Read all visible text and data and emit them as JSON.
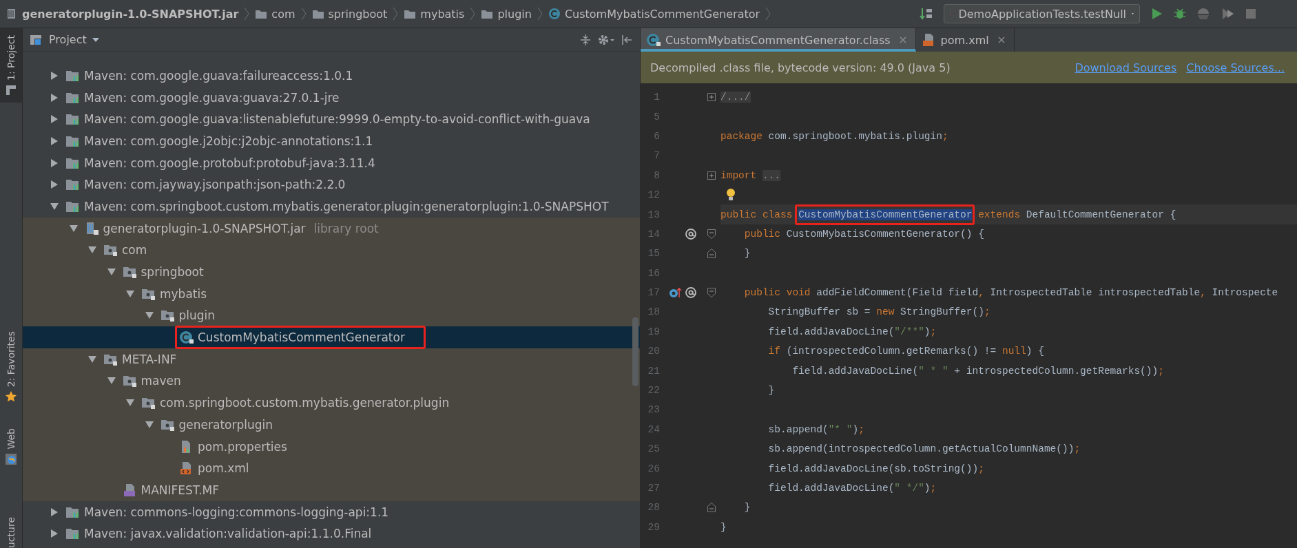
{
  "navigation_bar": {
    "breadcrumbs": [
      {
        "label": "generatorplugin-1.0-SNAPSHOT.jar",
        "kind": "jar"
      },
      {
        "label": "com",
        "kind": "package"
      },
      {
        "label": "springboot",
        "kind": "package"
      },
      {
        "label": "mybatis",
        "kind": "package"
      },
      {
        "label": "plugin",
        "kind": "package"
      },
      {
        "label": "CustomMybatisCommentGenerator",
        "kind": "class"
      }
    ],
    "run_configuration": {
      "label": "DemoApplicationTests.testNull"
    }
  },
  "side_tabs": [
    {
      "label": "1: Project",
      "kind": "project",
      "selected": true
    },
    {
      "label": "2: Favorites",
      "kind": "favorites",
      "selected": false
    },
    {
      "label": "Web",
      "kind": "web",
      "selected": false
    },
    {
      "label": "ucture",
      "kind": "structure",
      "selected": false
    }
  ],
  "project_panel": {
    "title": "Project",
    "tree": [
      {
        "label": "Maven: com.google.guava:failureaccess:1.0.1",
        "kind": "library",
        "expanded": false,
        "selected": false
      },
      {
        "label": "Maven: com.google.guava:guava:27.0.1-jre",
        "kind": "library",
        "expanded": false,
        "selected": false
      },
      {
        "label": "Maven: com.google.guava:listenablefuture:9999.0-empty-to-avoid-conflict-with-guava",
        "kind": "library",
        "expanded": false,
        "selected": false
      },
      {
        "label": "Maven: com.google.j2objc:j2objc-annotations:1.1",
        "kind": "library",
        "expanded": false,
        "selected": false
      },
      {
        "label": "Maven: com.google.protobuf:protobuf-java:3.11.4",
        "kind": "library",
        "expanded": false,
        "selected": false
      },
      {
        "label": "Maven: com.jayway.jsonpath:json-path:2.2.0",
        "kind": "library",
        "expanded": false,
        "selected": false
      },
      {
        "label": "Maven: com.springboot.custom.mybatis.generator.plugin:generatorplugin:1.0-SNAPSHOT",
        "kind": "library",
        "expanded": true,
        "selected": false,
        "children": [
          {
            "label": "generatorplugin-1.0-SNAPSHOT.jar",
            "hint": "library root",
            "kind": "jar",
            "expanded": true,
            "selected": false,
            "children": [
              {
                "label": "com",
                "kind": "package",
                "expanded": true,
                "selected": false,
                "children": [
                  {
                    "label": "springboot",
                    "kind": "package",
                    "expanded": true,
                    "selected": false,
                    "children": [
                      {
                        "label": "mybatis",
                        "kind": "package",
                        "expanded": true,
                        "selected": false,
                        "children": [
                          {
                            "label": "plugin",
                            "kind": "package",
                            "expanded": true,
                            "selected": false,
                            "children": [
                              {
                                "label": "CustomMybatisCommentGenerator",
                                "kind": "class",
                                "selected": true,
                                "annotated": true
                              }
                            ]
                          }
                        ]
                      }
                    ]
                  }
                ]
              },
              {
                "label": "META-INF",
                "kind": "package",
                "expanded": true,
                "selected": false,
                "children": [
                  {
                    "label": "maven",
                    "kind": "package",
                    "expanded": true,
                    "selected": false,
                    "children": [
                      {
                        "label": "com.springboot.custom.mybatis.generator.plugin",
                        "kind": "package",
                        "expanded": true,
                        "selected": false,
                        "children": [
                          {
                            "label": "generatorplugin",
                            "kind": "package",
                            "expanded": true,
                            "selected": false,
                            "children": [
                              {
                                "label": "pom.properties",
                                "kind": "properties",
                                "selected": false
                              },
                              {
                                "label": "pom.xml",
                                "kind": "xml",
                                "selected": false
                              }
                            ]
                          }
                        ]
                      }
                    ]
                  },
                  {
                    "label": "MANIFEST.MF",
                    "kind": "manifest",
                    "selected": false
                  }
                ]
              }
            ]
          }
        ]
      },
      {
        "label": "Maven: commons-logging:commons-logging-api:1.1",
        "kind": "library",
        "expanded": false,
        "selected": false
      },
      {
        "label": "Maven: javax.validation:validation-api:1.1.0.Final",
        "kind": "library",
        "expanded": false,
        "selected": false
      }
    ]
  },
  "editor": {
    "tabs": [
      {
        "label": "CustomMybatisCommentGenerator.class",
        "kind": "class",
        "selected": true
      },
      {
        "label": "pom.xml",
        "kind": "xml",
        "selected": false
      }
    ],
    "banner": {
      "text": "Decompiled .class file, bytecode version: 49.0 (Java 5)",
      "links": [
        "Download Sources",
        "Choose Sources..."
      ]
    },
    "lines": [
      {
        "number": "1",
        "fold_marker": {
          "kind": "plus"
        },
        "tokens": [
          {
            "text": "/.../",
            "kind": "folded"
          }
        ]
      },
      {
        "number": "5"
      },
      {
        "number": "6",
        "tokens": [
          {
            "text": "package",
            "kind": "kw"
          },
          {
            "text": " com.springboot.mybatis.plugin",
            "kind": "plain"
          },
          {
            "text": ";",
            "kind": "punct"
          }
        ]
      },
      {
        "number": "7"
      },
      {
        "number": "8",
        "fold_marker": {
          "kind": "plus"
        },
        "tokens": [
          {
            "text": "import ",
            "kind": "kw"
          },
          {
            "text": "...",
            "kind": "folded"
          }
        ]
      },
      {
        "number": "12",
        "bulb": true
      },
      {
        "number": "13",
        "current": true,
        "tokens": [
          {
            "text": "public class ",
            "kind": "kw"
          },
          {
            "text": "CustomMybatisCommentGenerator",
            "kind": "selected",
            "annotated": true
          },
          {
            "text": " extends",
            "kind": "kw"
          },
          {
            "text": " DefaultCommentGenerator {",
            "kind": "plain"
          }
        ]
      },
      {
        "number": "14",
        "gutter_icons": [
          {
            "kind": "at"
          }
        ],
        "fold_marker": {
          "kind": "open"
        },
        "tokens": [
          {
            "text": "    public",
            "kind": "kw"
          },
          {
            "text": " CustomMybatisCommentGenerator() {",
            "kind": "plain"
          }
        ]
      },
      {
        "number": "15",
        "fold_marker": {
          "kind": "close"
        },
        "tokens": [
          {
            "text": "    }",
            "kind": "plain"
          }
        ]
      },
      {
        "number": "16"
      },
      {
        "number": "17",
        "gutter_icons": [
          {
            "kind": "override"
          },
          {
            "kind": "at"
          }
        ],
        "fold_marker": {
          "kind": "open"
        },
        "tokens": [
          {
            "text": "    public void",
            "kind": "kw"
          },
          {
            "text": " addFieldComment(Field field",
            "kind": "plain"
          },
          {
            "text": ",",
            "kind": "punct"
          },
          {
            "text": " IntrospectedTable introspectedTable",
            "kind": "plain"
          },
          {
            "text": ",",
            "kind": "punct"
          },
          {
            "text": " Introspecte",
            "kind": "plain"
          }
        ]
      },
      {
        "number": "18",
        "tokens": [
          {
            "text": "        StringBuffer sb = ",
            "kind": "plain"
          },
          {
            "text": "new",
            "kind": "kw"
          },
          {
            "text": " StringBuffer()",
            "kind": "plain"
          },
          {
            "text": ";",
            "kind": "punct"
          }
        ]
      },
      {
        "number": "19",
        "tokens": [
          {
            "text": "        field.addJavaDocLine(",
            "kind": "plain"
          },
          {
            "text": "\"/**\"",
            "kind": "str"
          },
          {
            "text": ")",
            "kind": "plain"
          },
          {
            "text": ";",
            "kind": "punct"
          }
        ]
      },
      {
        "number": "20",
        "tokens": [
          {
            "text": "        if",
            "kind": "kw"
          },
          {
            "text": " (introspectedColumn.getRemarks() != ",
            "kind": "plain"
          },
          {
            "text": "null",
            "kind": "kw"
          },
          {
            "text": ") {",
            "kind": "plain"
          }
        ]
      },
      {
        "number": "21",
        "tokens": [
          {
            "text": "            field.addJavaDocLine(",
            "kind": "plain"
          },
          {
            "text": "\" * \"",
            "kind": "str"
          },
          {
            "text": " + introspectedColumn.getRemarks())",
            "kind": "plain"
          },
          {
            "text": ";",
            "kind": "punct"
          }
        ]
      },
      {
        "number": "22",
        "tokens": [
          {
            "text": "        }",
            "kind": "plain"
          }
        ]
      },
      {
        "number": "23"
      },
      {
        "number": "24",
        "tokens": [
          {
            "text": "        sb.append(",
            "kind": "plain"
          },
          {
            "text": "\"* \"",
            "kind": "str"
          },
          {
            "text": ")",
            "kind": "plain"
          },
          {
            "text": ";",
            "kind": "punct"
          }
        ]
      },
      {
        "number": "25",
        "tokens": [
          {
            "text": "        sb.append(introspectedColumn.getActualColumnName())",
            "kind": "plain"
          },
          {
            "text": ";",
            "kind": "punct"
          }
        ]
      },
      {
        "number": "26",
        "tokens": [
          {
            "text": "        field.addJavaDocLine(sb.toString())",
            "kind": "plain"
          },
          {
            "text": ";",
            "kind": "punct"
          }
        ]
      },
      {
        "number": "27",
        "tokens": [
          {
            "text": "        field.addJavaDocLine(",
            "kind": "plain"
          },
          {
            "text": "\" */\"",
            "kind": "str"
          },
          {
            "text": ")",
            "kind": "plain"
          },
          {
            "text": ";",
            "kind": "punct"
          }
        ]
      },
      {
        "number": "28",
        "fold_marker": {
          "kind": "close"
        },
        "tokens": [
          {
            "text": "    }",
            "kind": "plain"
          }
        ]
      },
      {
        "number": "29",
        "tokens": [
          {
            "text": "}",
            "kind": "plain"
          }
        ]
      }
    ]
  }
}
